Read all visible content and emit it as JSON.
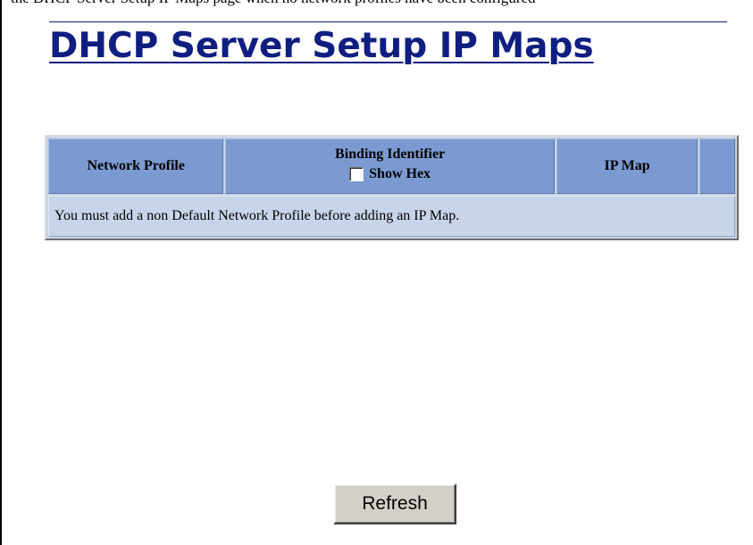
{
  "page": {
    "top_text": "the DHCP Server Setup IP Maps page when no network profiles have been configured",
    "title": "DHCP Server Setup IP Maps"
  },
  "table": {
    "headers": {
      "network_profile": "Network Profile",
      "binding_identifier": "Binding Identifier",
      "show_hex_label": "Show Hex",
      "ip_map": "IP Map",
      "extra": ""
    },
    "show_hex_checked": false,
    "message": "You must add a non Default Network Profile before adding an IP Map."
  },
  "actions": {
    "refresh_label": "Refresh"
  },
  "colors": {
    "title": "#0f1e80",
    "header_bg": "#7b9ad1",
    "row_bg": "#c8d4e9",
    "button_bg": "#d4d0c8"
  }
}
